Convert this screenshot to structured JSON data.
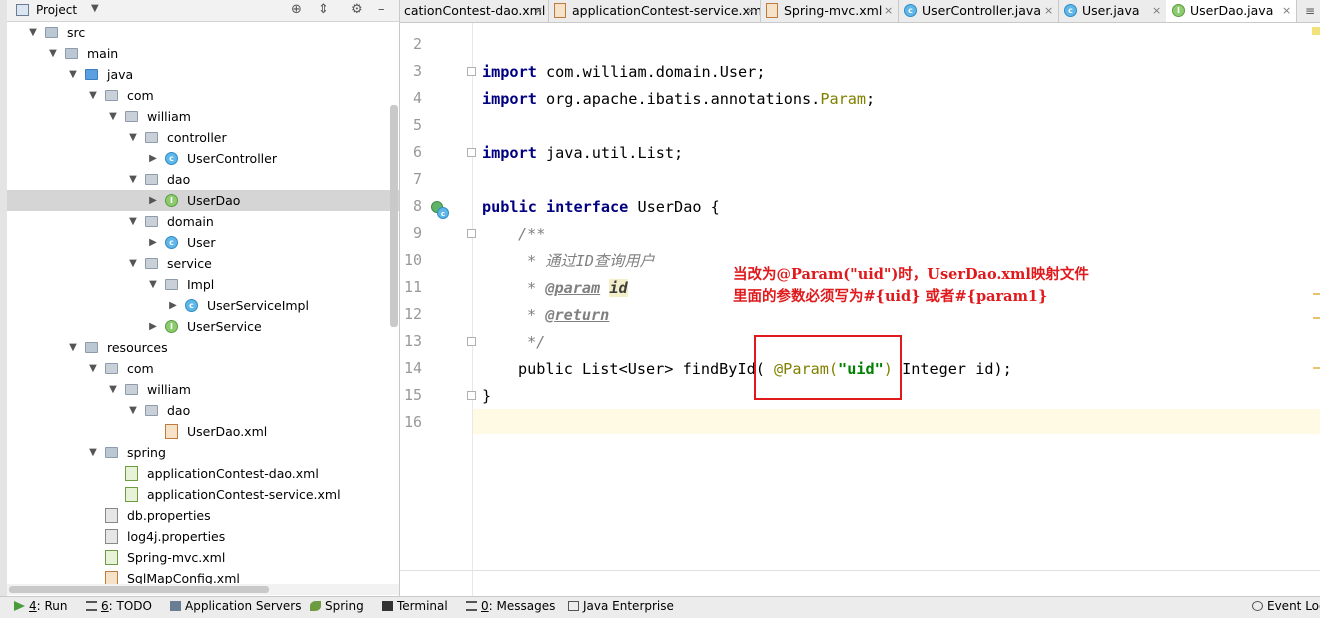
{
  "project_panel": {
    "title": "Project",
    "tree": [
      {
        "label": "src",
        "depth": 1,
        "icon": "folder-icon",
        "expanded": true
      },
      {
        "label": "main",
        "depth": 2,
        "icon": "folder-icon",
        "expanded": true
      },
      {
        "label": "java",
        "depth": 3,
        "icon": "source-folder-icon",
        "expanded": true
      },
      {
        "label": "com",
        "depth": 4,
        "icon": "package-icon",
        "expanded": true
      },
      {
        "label": "william",
        "depth": 5,
        "icon": "package-icon",
        "expanded": true
      },
      {
        "label": "controller",
        "depth": 6,
        "icon": "package-icon",
        "expanded": true
      },
      {
        "label": "UserController",
        "depth": 7,
        "icon": "class-icon",
        "expanded": false
      },
      {
        "label": "dao",
        "depth": 6,
        "icon": "package-icon",
        "expanded": true
      },
      {
        "label": "UserDao",
        "depth": 7,
        "icon": "interface-icon",
        "expanded": false,
        "selected": true
      },
      {
        "label": "domain",
        "depth": 6,
        "icon": "package-icon",
        "expanded": true
      },
      {
        "label": "User",
        "depth": 7,
        "icon": "class-icon",
        "expanded": false
      },
      {
        "label": "service",
        "depth": 6,
        "icon": "package-icon",
        "expanded": true
      },
      {
        "label": "Impl",
        "depth": 7,
        "icon": "package-icon",
        "expanded": true
      },
      {
        "label": "UserServiceImpl",
        "depth": 8,
        "icon": "class-icon",
        "expanded": false
      },
      {
        "label": "UserService",
        "depth": 7,
        "icon": "interface-icon",
        "expanded": false
      },
      {
        "label": "resources",
        "depth": 3,
        "icon": "resources-folder-icon",
        "expanded": true
      },
      {
        "label": "com",
        "depth": 4,
        "icon": "package-icon",
        "expanded": true
      },
      {
        "label": "william",
        "depth": 5,
        "icon": "package-icon",
        "expanded": true
      },
      {
        "label": "dao",
        "depth": 6,
        "icon": "package-icon",
        "expanded": true
      },
      {
        "label": "UserDao.xml",
        "depth": 7,
        "icon": "xml-file-icon",
        "leaf": true
      },
      {
        "label": "spring",
        "depth": 4,
        "icon": "folder-icon",
        "expanded": true
      },
      {
        "label": "applicationContest-dao.xml",
        "depth": 5,
        "icon": "spring-xml-icon",
        "leaf": true
      },
      {
        "label": "applicationContest-service.xml",
        "depth": 5,
        "icon": "spring-xml-icon",
        "leaf": true
      },
      {
        "label": "db.properties",
        "depth": 4,
        "icon": "properties-file-icon",
        "leaf": true
      },
      {
        "label": "log4j.properties",
        "depth": 4,
        "icon": "properties-file-icon",
        "leaf": true
      },
      {
        "label": "Spring-mvc.xml",
        "depth": 4,
        "icon": "spring-xml-icon",
        "leaf": true
      },
      {
        "label": "SqlMapConfig.xml",
        "depth": 4,
        "icon": "xml-file-icon",
        "leaf": true
      }
    ]
  },
  "tabs": [
    {
      "label": "cationContest-dao.xml",
      "icon": "spring-xml-icon",
      "active": false
    },
    {
      "label": "applicationContest-service.xml",
      "icon": "spring-xml-icon",
      "active": false
    },
    {
      "label": "Spring-mvc.xml",
      "icon": "spring-xml-icon",
      "active": false
    },
    {
      "label": "UserController.java",
      "icon": "class-icon",
      "active": false
    },
    {
      "label": "User.java",
      "icon": "class-icon",
      "active": false
    },
    {
      "label": "UserDao.java",
      "icon": "interface-icon",
      "active": true
    }
  ],
  "tab_close_glyph": "×",
  "tab_menu_glyph": "≡",
  "editor": {
    "line_numbers": [
      "2",
      "3",
      "4",
      "5",
      "6",
      "7",
      "8",
      "9",
      "10",
      "11",
      "12",
      "13",
      "14",
      "15",
      "16"
    ],
    "code": {
      "l3_kw": "import",
      "l3_rest": " com.william.domain.User;",
      "l4_kw": "import",
      "l4_pkg": " org.apache.ibatis.annotations.",
      "l4_ann": "Param",
      "l4_end": ";",
      "l6_kw": "import",
      "l6_rest": " java.util.List;",
      "l8_kw1": "public",
      "l8_kw2": "interface",
      "l8_rest": " UserDao {",
      "l9": "/**",
      "l10": "* 通过ID查询用户",
      "l11_star": "* ",
      "l11_tag": "@param",
      "l11_val": "id",
      "l12_star": "* ",
      "l12_tag": "@return",
      "l13": "*/",
      "l14_pre": "public List<User> findById( ",
      "l14_ann": "@Param(",
      "l14_str": "\"uid\"",
      "l14_close": ")",
      "l14_post": " Integer id);",
      "l15": "}"
    },
    "annotation_line1": "当改为@Param(\"uid\")时，UserDao.xml映射文件",
    "annotation_line2": "里面的参数必须写为#{uid} 或者#{param1}"
  },
  "bottom_bar": {
    "run": {
      "mnemonic": "4",
      "label": ": Run"
    },
    "todo": {
      "mnemonic": "6",
      "label": ": TODO"
    },
    "app_servers": "Application Servers",
    "spring": "Spring",
    "terminal": "Terminal",
    "messages": {
      "mnemonic": "0",
      "label": ": Messages"
    },
    "java_enterprise": "Java Enterprise",
    "event_log": "Event Log"
  },
  "colors": {
    "keyword": "#000080",
    "annotation": "#808000",
    "string": "#008000",
    "comment": "#808080",
    "highlight_red": "#e0191c",
    "selection": "#d5d5d5"
  }
}
